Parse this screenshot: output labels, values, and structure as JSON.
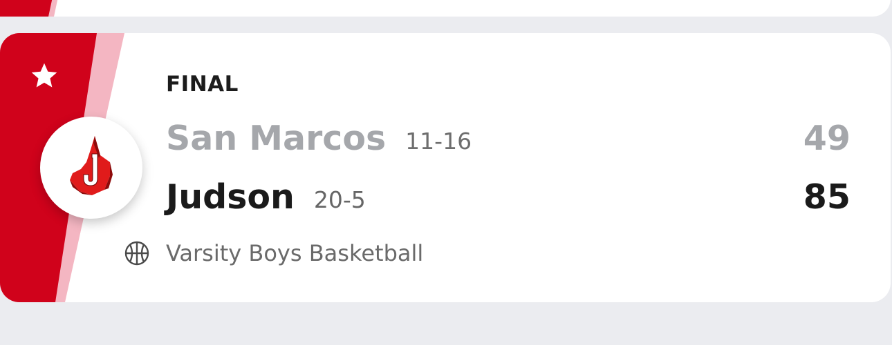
{
  "colors": {
    "page_background": "#ebecf0",
    "team_red": "#d0021b",
    "team_pink": "#f4b6c2",
    "card_background": "#ffffff"
  },
  "game": {
    "status": "FINAL",
    "away": {
      "name": "San Marcos",
      "record": "11-16",
      "score": "49"
    },
    "home": {
      "name": "Judson",
      "record": "20-5",
      "score": "85",
      "logo_icon": "judson-j-logo-icon"
    },
    "sport": {
      "icon": "basketball-icon",
      "label": "Varsity Boys Basketball"
    },
    "favorite_icon": "star-icon"
  }
}
